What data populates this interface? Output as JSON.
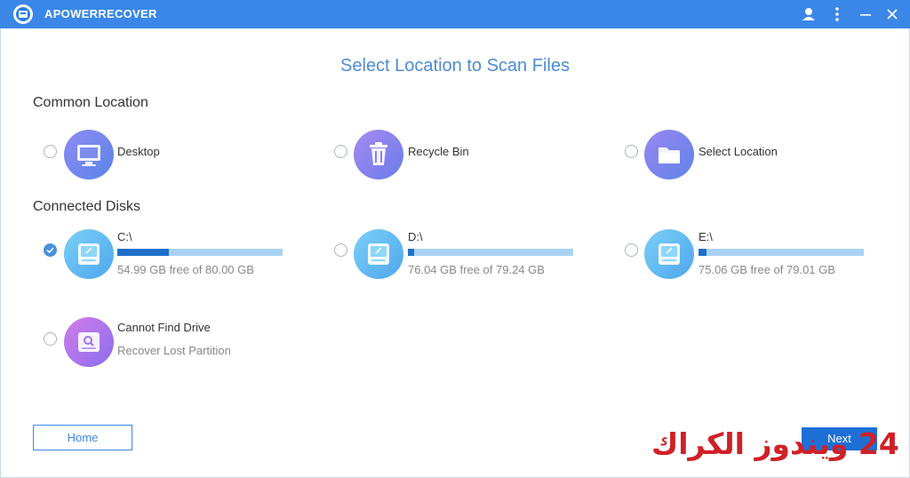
{
  "app": {
    "title": "APOWERRECOVER"
  },
  "page": {
    "heading": "Select Location to Scan Files"
  },
  "sections": {
    "common": "Common Location",
    "disks": "Connected Disks"
  },
  "common_locations": [
    {
      "label": "Desktop",
      "icon": "monitor-icon"
    },
    {
      "label": "Recycle Bin",
      "icon": "trash-icon"
    },
    {
      "label": "Select Location",
      "icon": "folder-icon"
    }
  ],
  "disks": [
    {
      "label": "C:\\",
      "free": "54.99 GB free of 80.00 GB",
      "used_fraction": 0.31,
      "selected": true
    },
    {
      "label": "D:\\",
      "free": "76.04 GB free of 79.24 GB",
      "used_fraction": 0.04,
      "selected": false
    },
    {
      "label": "E:\\",
      "free": "75.06 GB free of 79.01 GB",
      "used_fraction": 0.05,
      "selected": false
    }
  ],
  "cannot_find": {
    "label": "Cannot Find Drive",
    "sub": "Recover Lost Partition"
  },
  "buttons": {
    "home": "Home",
    "next": "Next"
  },
  "watermark": "24 ويندوز الكراك",
  "colors": {
    "titlebar": "#3a87e8",
    "heading": "#4b8bd6",
    "accent": "#1e6fd6",
    "bar_fill": "#1e70c9",
    "bar_track": "#a8d2f4",
    "watermark": "#cf2027"
  }
}
